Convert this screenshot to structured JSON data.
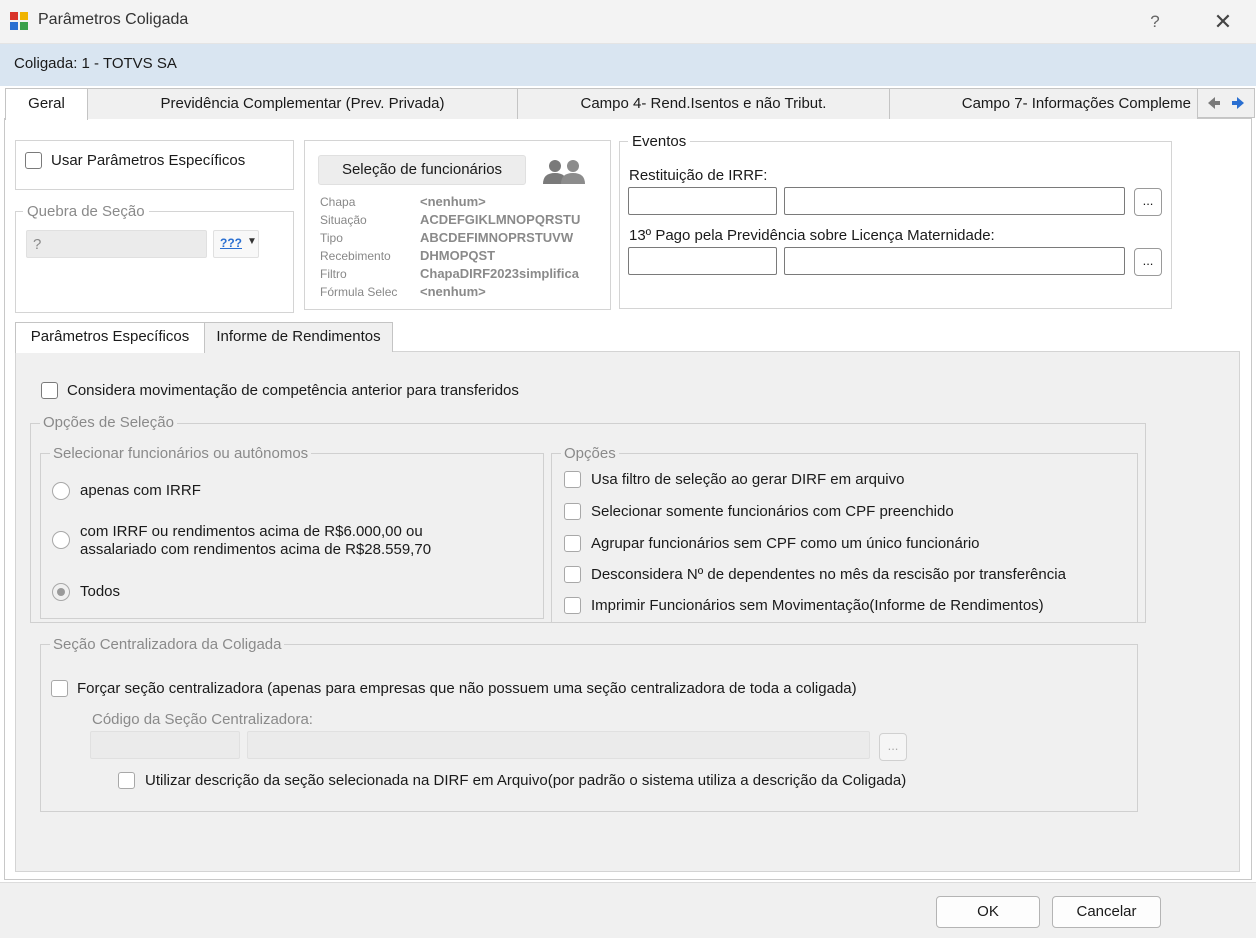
{
  "window": {
    "title": "Parâmetros Coligada",
    "help": "?",
    "close": "✕"
  },
  "coligada": "Coligada: 1 - TOTVS SA",
  "tabs": [
    {
      "label": "Geral"
    },
    {
      "label": "Previdência Complementar (Prev. Privada)"
    },
    {
      "label": "Campo 4- Rend.Isentos e não Tribut."
    },
    {
      "label": "Campo 7- Informações Compleme"
    }
  ],
  "usar_parametros": "Usar Parâmetros Específicos",
  "quebra_secao": {
    "legend": "Quebra de Seção",
    "value": "?",
    "dropdown_label": "???"
  },
  "selecao": {
    "button": "Seleção de funcionários",
    "rows": [
      {
        "label": "Chapa",
        "value": "<nenhum>"
      },
      {
        "label": "Situação",
        "value": "ACDEFGIKLMNOPQRSTU"
      },
      {
        "label": "Tipo",
        "value": "ABCDEFIMNOPRSTUVW"
      },
      {
        "label": "Recebimento",
        "value": "DHMOPQST"
      },
      {
        "label": "Filtro",
        "value": "ChapaDIRF2023simplifica"
      },
      {
        "label": "Fórmula Selec",
        "value": "<nenhum>"
      }
    ]
  },
  "eventos": {
    "legend": "Eventos",
    "restituicao_label": "Restituição de IRRF:",
    "pago_label": "13º Pago pela Previdência sobre Licença Maternidade:",
    "dots": "..."
  },
  "subtabs": [
    {
      "label": "Parâmetros Específicos"
    },
    {
      "label": "Informe de Rendimentos"
    }
  ],
  "considera_label": "Considera movimentação de competência anterior para transferidos",
  "opcoes_selecao": {
    "legend": "Opções de Seleção",
    "selecionar": {
      "legend": "Selecionar funcionários ou autônomos",
      "radios": [
        {
          "label": "apenas com IRRF"
        },
        {
          "label_line1": "com IRRF ou rendimentos acima de R$6.000,00 ou",
          "label_line2": "assalariado com rendimentos acima de R$28.559,70"
        },
        {
          "label": "Todos"
        }
      ]
    },
    "opcoes": {
      "legend": "Opções",
      "items": [
        "Usa filtro de seleção ao gerar DIRF em arquivo",
        "Selecionar somente funcionários com CPF preenchido",
        "Agrupar funcionários sem CPF como um único funcionário",
        "Desconsidera Nº de dependentes no mês da rescisão por transferência",
        "Imprimir Funcionários sem Movimentação(Informe de Rendimentos)"
      ]
    }
  },
  "secao_centralizadora": {
    "legend": "Seção Centralizadora da Coligada",
    "forcar_label": "Forçar seção centralizadora  (apenas para empresas que não possuem uma seção centralizadora de toda a coligada)",
    "codigo_label": "Código da Seção Centralizadora:",
    "dots": "...",
    "utilizar_label": "Utilizar descrição da seção selecionada na DIRF em Arquivo(por padrão o sistema utiliza a descrição da Coligada)"
  },
  "footer": {
    "ok": "OK",
    "cancel": "Cancelar"
  }
}
